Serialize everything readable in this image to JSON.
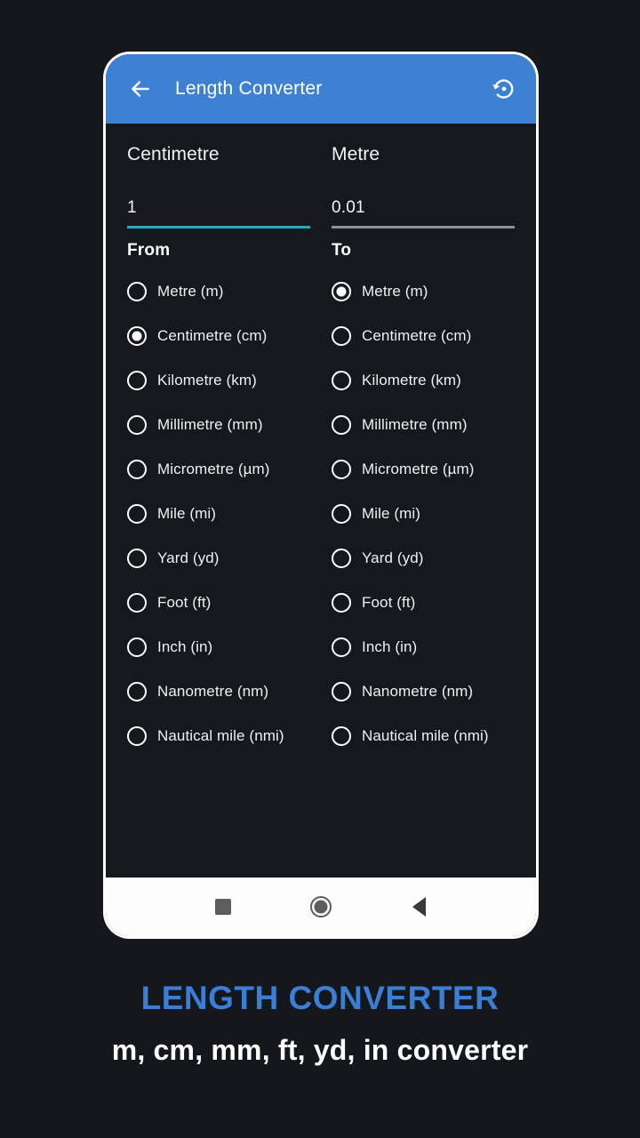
{
  "app": {
    "title": "Length Converter",
    "back_icon": "arrow-left-icon",
    "reset_icon": "restore-history-icon",
    "header_color": "#3e81d2",
    "accent_color": "#27a8cb",
    "background_color": "#15181c"
  },
  "conversion": {
    "from": {
      "unit_name": "Centimetre",
      "value": "1",
      "placeholder": "Enter value",
      "section_label": "From",
      "selected_unit": "Centimetre (cm)",
      "underline_color": "#27a8cb"
    },
    "to": {
      "unit_name": "Metre",
      "value": "0.01",
      "placeholder": "Result",
      "section_label": "To",
      "selected_unit": "Metre (m)",
      "underline_color": "#8e9296"
    }
  },
  "units": [
    "Metre (m)",
    "Centimetre (cm)",
    "Kilometre (km)",
    "Millimetre (mm)",
    "Micrometre (µm)",
    "Mile (mi)",
    "Yard (yd)",
    "Foot (ft)",
    "Inch (in)",
    "Nanometre (nm)",
    "Nautical mile (nmi)"
  ],
  "navbar": {
    "recents_label": "recents-square-icon",
    "home_label": "home-circle-icon",
    "back_label": "back-triangle-icon"
  },
  "caption": {
    "title": "LENGTH CONVERTER",
    "subtitle": "m, cm, mm, ft, yd, in converter",
    "title_color": "#3a7fd5",
    "subtitle_color": "#ffffff"
  }
}
